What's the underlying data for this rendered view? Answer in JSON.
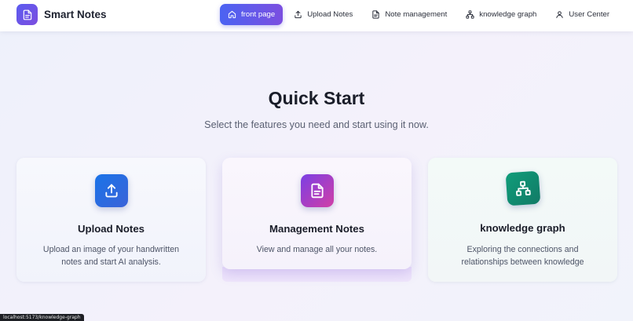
{
  "brand": {
    "name": "Smart Notes",
    "icon": "document-icon"
  },
  "nav": {
    "items": [
      {
        "label": "front page",
        "icon": "home-icon",
        "active": true
      },
      {
        "label": "Upload Notes",
        "icon": "upload-icon",
        "active": false
      },
      {
        "label": "Note management",
        "icon": "file-icon",
        "active": false
      },
      {
        "label": "knowledge graph",
        "icon": "graph-icon",
        "active": false
      },
      {
        "label": "User Center",
        "icon": "user-icon",
        "active": false
      }
    ]
  },
  "hero": {
    "title": "Quick Start",
    "subtitle": "Select the features you need and start using it now."
  },
  "cards": [
    {
      "title": "Upload Notes",
      "description": "Upload an image of your handwritten notes and start AI analysis.",
      "icon": "upload-icon",
      "color": "#1a73e8"
    },
    {
      "title": "Management Notes",
      "description": "View and manage all your notes.",
      "icon": "document-icon",
      "color": "#9b3fd0"
    },
    {
      "title": "knowledge graph",
      "description": "Exploring the connections and relationships between knowledge",
      "icon": "graph-icon",
      "color": "#0f9d7a"
    }
  ],
  "status_bar": {
    "url": "localhost:5173/knowledge-graph"
  },
  "colors": {
    "accent_start": "#4b63f2",
    "accent_end": "#7b4fe0"
  }
}
